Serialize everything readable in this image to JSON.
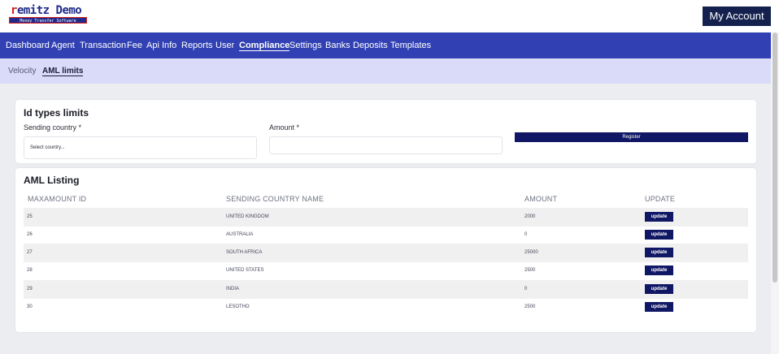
{
  "logo": {
    "brand_first": "r",
    "brand_rest": "emitz Demo",
    "tagline": "Money Transfer Software"
  },
  "header": {
    "account_button": "My Account"
  },
  "nav": {
    "items": [
      {
        "label": "Dashboard",
        "active": false
      },
      {
        "label": "Agent",
        "active": false
      },
      {
        "label": "Transaction",
        "active": false
      },
      {
        "label": "Fee",
        "active": false
      },
      {
        "label": "Api Info",
        "active": false
      },
      {
        "label": "Reports",
        "active": false
      },
      {
        "label": "User",
        "active": false
      },
      {
        "label": "Compliance",
        "active": true
      },
      {
        "label": "Settings",
        "active": false
      },
      {
        "label": "Banks",
        "active": false
      },
      {
        "label": "Deposits",
        "active": false
      },
      {
        "label": "Templates",
        "active": false
      }
    ]
  },
  "subnav": {
    "items": [
      {
        "label": "Velocity",
        "active": false
      },
      {
        "label": "AML limits",
        "active": true
      }
    ]
  },
  "form": {
    "title": "Id types limits",
    "sending_country_label": "Sending country *",
    "sending_country_placeholder": "Select country...",
    "amount_label": "Amount *",
    "amount_value": "",
    "register_button": "Register"
  },
  "listing": {
    "title": "AML Listing",
    "columns": [
      "MAXAMOUNT ID",
      "SENDING COUNTRY NAME",
      "AMOUNT",
      "UPDATE"
    ],
    "rows": [
      {
        "id": "25",
        "country": "UNITED KINGDOM",
        "amount": "2000",
        "action": "update"
      },
      {
        "id": "26",
        "country": "AUSTRALIA",
        "amount": "0",
        "action": "update"
      },
      {
        "id": "27",
        "country": "SOUTH AFRICA",
        "amount": "25000",
        "action": "update"
      },
      {
        "id": "28",
        "country": "UNITED STATES",
        "amount": "2500",
        "action": "update"
      },
      {
        "id": "29",
        "country": "INDIA",
        "amount": "0",
        "action": "update"
      },
      {
        "id": "30",
        "country": "LESOTHO",
        "amount": "2500",
        "action": "update"
      }
    ]
  },
  "colors": {
    "nav_bg": "#3141b3",
    "subnav_bg": "#d9dbf8",
    "button_dark": "#101764",
    "account_btn": "#14214f",
    "row_stripe": "#f0f0f0",
    "page_bg": "#ebedf0"
  }
}
